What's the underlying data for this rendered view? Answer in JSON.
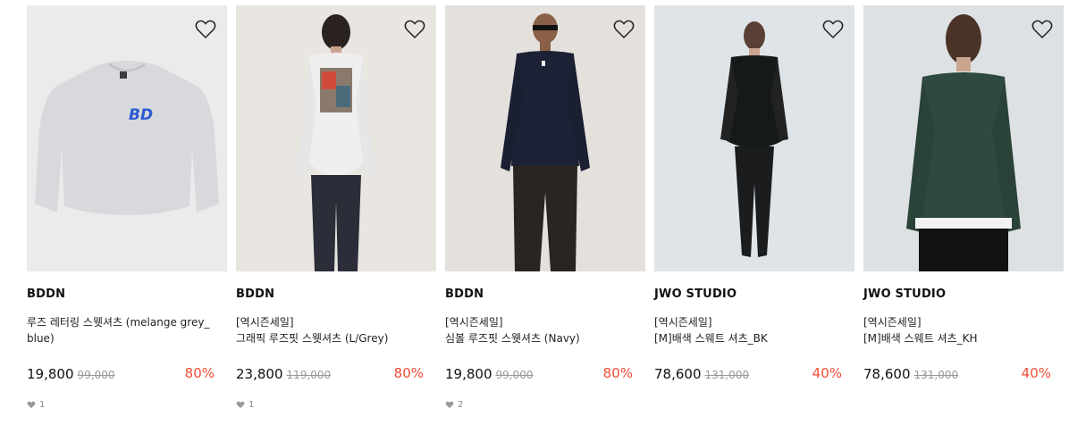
{
  "products": [
    {
      "brand": "BDDN",
      "tag": "",
      "name": "루즈 레터링 스웻셔츠 (melange grey_ blue)",
      "price": "19,800",
      "original_price": "99,000",
      "discount": "80%",
      "likes": "1",
      "logo_text": "BD",
      "wishlist_icon": "heart-outline-icon"
    },
    {
      "brand": "BDDN",
      "tag": "[역시즌세일]",
      "name": "그래픽 루즈핏 스웻셔츠 (L/Grey)",
      "price": "23,800",
      "original_price": "119,000",
      "discount": "80%",
      "likes": "1",
      "wishlist_icon": "heart-outline-icon"
    },
    {
      "brand": "BDDN",
      "tag": "[역시즌세일]",
      "name": "심볼 루즈핏 스웻셔츠 (Navy)",
      "price": "19,800",
      "original_price": "99,000",
      "discount": "80%",
      "likes": "2",
      "wishlist_icon": "heart-outline-icon"
    },
    {
      "brand": "JWO STUDIO",
      "tag": "[역시즌세일]",
      "name": "[M]배색 스웨트 셔츠_BK",
      "price": "78,600",
      "original_price": "131,000",
      "discount": "40%",
      "likes": "",
      "wishlist_icon": "heart-outline-icon"
    },
    {
      "brand": "JWO STUDIO",
      "tag": "[역시즌세일]",
      "name": "[M]배색 스웨트 셔츠_KH",
      "price": "78,600",
      "original_price": "131,000",
      "discount": "40%",
      "likes": "",
      "wishlist_icon": "heart-outline-icon"
    }
  ],
  "colors": {
    "discount": "#ef4c36",
    "text": "#222222",
    "muted": "#999999",
    "image_bg": "#ebebeb"
  }
}
